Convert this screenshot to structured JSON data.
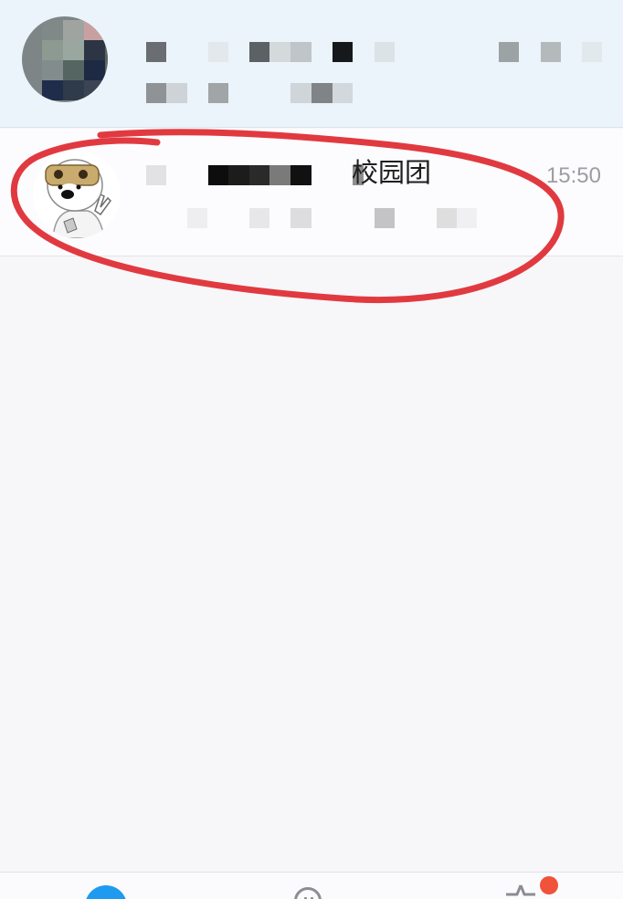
{
  "conversation": {
    "title_visible_fragment": "校园团",
    "time": "15:50"
  },
  "annotation": {
    "type": "hand-drawn-ellipse",
    "color": "#e03a40"
  },
  "tab_bar": {
    "messages_badge_color": "#1e9bf0",
    "notification_dot_color": "#f0533a"
  },
  "icons": {
    "header_avatar": "pixelated-photo-avatar",
    "conversation_avatar": "cartoon-dog-avatar",
    "messages_tab": "chat-bubble-icon",
    "contacts_tab": "smiley-face-icon",
    "discover_tab": "star-icon"
  }
}
